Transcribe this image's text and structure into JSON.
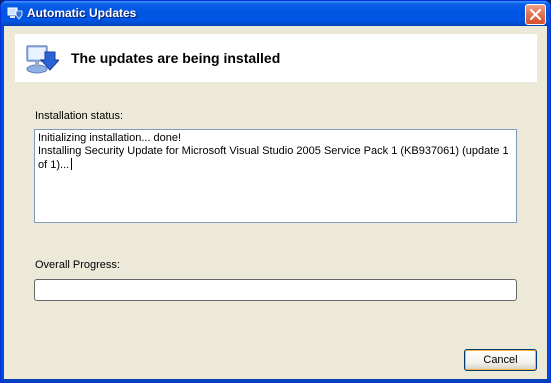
{
  "window": {
    "title": "Automatic Updates"
  },
  "header": {
    "title": "The updates are being installed",
    "icon": "windows-update-icon"
  },
  "status": {
    "label": "Installation status:",
    "text": "Initializing installation... done!\nInstalling Security Update for Microsoft Visual Studio 2005 Service Pack 1 (KB937061) (update 1 of 1)..."
  },
  "progress": {
    "label": "Overall Progress:",
    "value": 0
  },
  "buttons": {
    "cancel": "Cancel"
  },
  "colors": {
    "titlebar": "#0054e3",
    "dialog_bg": "#ece9d8",
    "progress_fill": "#2ad041"
  }
}
